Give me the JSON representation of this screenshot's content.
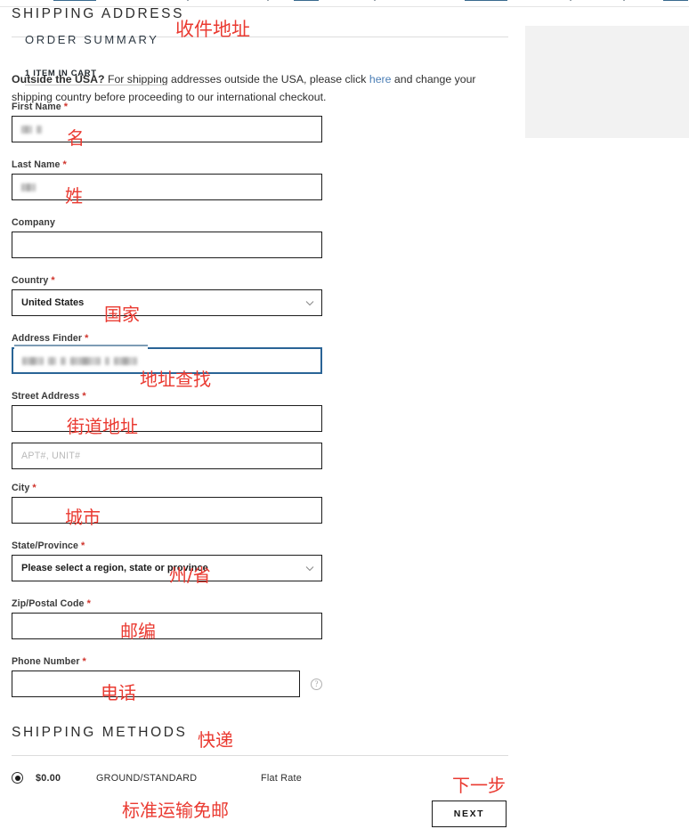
{
  "sections": {
    "shipping_address": {
      "heading": "SHIPPING ADDRESS",
      "annotation": "收件地址",
      "intro_bold": "Outside the USA?",
      "intro_rest_1": " For shipping addresses outside the USA, please click ",
      "intro_link": "here",
      "intro_rest_2": " and change your shipping country before proceeding to our international checkout."
    },
    "shipping_methods": {
      "heading": "SHIPPING METHODS",
      "annotation": "快递"
    }
  },
  "fields": {
    "first_name": {
      "label": "First Name",
      "required": true,
      "value": "",
      "annotation": "名"
    },
    "last_name": {
      "label": "Last Name",
      "required": true,
      "value": "",
      "annotation": "姓"
    },
    "company": {
      "label": "Company",
      "required": false,
      "value": ""
    },
    "country": {
      "label": "Country",
      "required": true,
      "value": "United States",
      "annotation": "国家"
    },
    "address_finder": {
      "label": "Address Finder",
      "required": true,
      "value": "",
      "annotation": "地址查找",
      "focused": true
    },
    "street_address": {
      "label": "Street Address",
      "required": true,
      "value": "",
      "annotation": "街道地址"
    },
    "street_address_2": {
      "label": "",
      "required": false,
      "value": "",
      "placeholder": "APT#, UNIT#"
    },
    "city": {
      "label": "City",
      "required": true,
      "value": "",
      "annotation": "城市"
    },
    "state_province": {
      "label": "State/Province",
      "required": true,
      "value": "Please select a region, state or province",
      "annotation": "州/省"
    },
    "zip": {
      "label": "Zip/Postal Code",
      "required": true,
      "value": "",
      "annotation": "邮编"
    },
    "phone": {
      "label": "Phone Number",
      "required": true,
      "value": "",
      "annotation": "电话",
      "help_icon": "question-mark-icon"
    }
  },
  "shipping_option": {
    "selected": true,
    "price": "$0.00",
    "method": "GROUND/STANDARD",
    "rate": "Flat Rate",
    "annotation": "标准运输免邮"
  },
  "next_button": {
    "label": "NEXT",
    "annotation": "下一步"
  },
  "order_summary": {
    "title": "ORDER SUMMARY",
    "item_count": "1 ITEM IN CART"
  },
  "colors": {
    "annotation_red": "#ea3a31",
    "link_blue": "#4b7eb5",
    "required_red": "#d0342c",
    "summary_bg": "#f2f2f2",
    "focus_blue": "#2a6496"
  }
}
